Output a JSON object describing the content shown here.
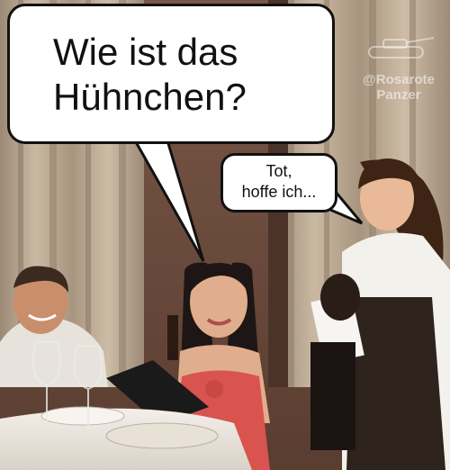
{
  "speech_bubbles": {
    "customer_question": "Wie ist das\nHühnchen?",
    "waitress_answer": "Tot,\nhoffe ich..."
  },
  "watermark": {
    "text": "@Rosarote\nPanzer"
  },
  "colors": {
    "bubble_fill": "#ffffff",
    "bubble_stroke": "#111111",
    "curtain": "#b9a68f",
    "wall": "#6b4a3a"
  }
}
